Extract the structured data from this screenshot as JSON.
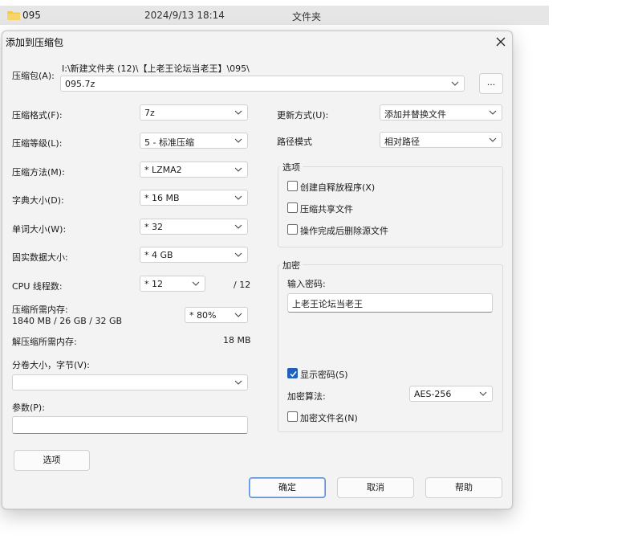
{
  "explorer": {
    "name": "095",
    "date": "2024/9/13 18:14",
    "type": "文件夹"
  },
  "dialog": {
    "title": "添加到压缩包",
    "archive": {
      "label": "压缩包(A):",
      "path": "I:\\新建文件夹 (12)\\【上老王论坛当老王】\\095\\",
      "value": "095.7z",
      "browse_label": "..."
    },
    "format": {
      "label": "压缩格式(F):",
      "value": "7z"
    },
    "level": {
      "label": "压缩等级(L):",
      "value": "5 - 标准压缩"
    },
    "method": {
      "label": "压缩方法(M):",
      "value": "*  LZMA2"
    },
    "dict": {
      "label": "字典大小(D):",
      "value": "*  16 MB"
    },
    "word": {
      "label": "单词大小(W):",
      "value": "*  32"
    },
    "solid": {
      "label": "固实数据大小:",
      "value": "*  4 GB"
    },
    "threads": {
      "label": "CPU 线程数:",
      "value": "*  12",
      "max": "/ 12"
    },
    "memory": {
      "label": "压缩所需内存:",
      "detail": "1840 MB / 26 GB / 32 GB",
      "value": "*  80%"
    },
    "decomp_memory": {
      "label": "解压缩所需内存:",
      "value": "18 MB"
    },
    "volume": {
      "label": "分卷大小，字节(V):",
      "value": ""
    },
    "params": {
      "label": "参数(P):",
      "value": ""
    },
    "options_button": "选项",
    "update": {
      "label": "更新方式(U):",
      "value": "添加并替换文件"
    },
    "path_mode": {
      "label": "路径模式",
      "value": "相对路径"
    },
    "options_group": {
      "title": "选项",
      "sfx": "创建自释放程序(X)",
      "shared": "压缩共享文件",
      "delete": "操作完成后删除源文件"
    },
    "encryption": {
      "title": "加密",
      "password_label": "输入密码:",
      "password": "上老王论坛当老王",
      "show_password": "显示密码(S)",
      "method_label": "加密算法:",
      "method": "AES-256",
      "encrypt_names": "加密文件名(N)"
    },
    "buttons": {
      "ok": "确定",
      "cancel": "取消",
      "help": "帮助"
    }
  },
  "colors": {
    "accent": "#1f5fbf",
    "folder": "#f2c94c",
    "dialog_bg": "#f3f3f3"
  }
}
